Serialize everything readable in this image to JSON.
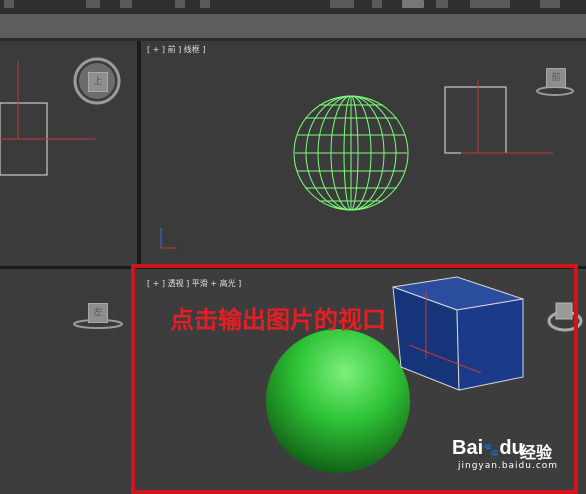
{
  "viewports": {
    "front": {
      "label": "[ + ] 前 ] 线框 ]",
      "cube_label": "前"
    },
    "top": {
      "cube_label": "上"
    },
    "left": {
      "cube_label": "左"
    },
    "perspective": {
      "label": "[ + ] 透视 ] 平滑 + 高光 ]"
    }
  },
  "annotation": {
    "text": "点击输出图片的视口"
  },
  "watermark": {
    "brand": "Bai",
    "brand_paw": "du",
    "brand2": "经验",
    "url": "jingyan.baidu.com"
  },
  "colors": {
    "highlight": "#d1161b",
    "wire_sphere": "#7dff7d",
    "shaded_sphere": "#2fc437",
    "box": "#1c3a8a"
  }
}
